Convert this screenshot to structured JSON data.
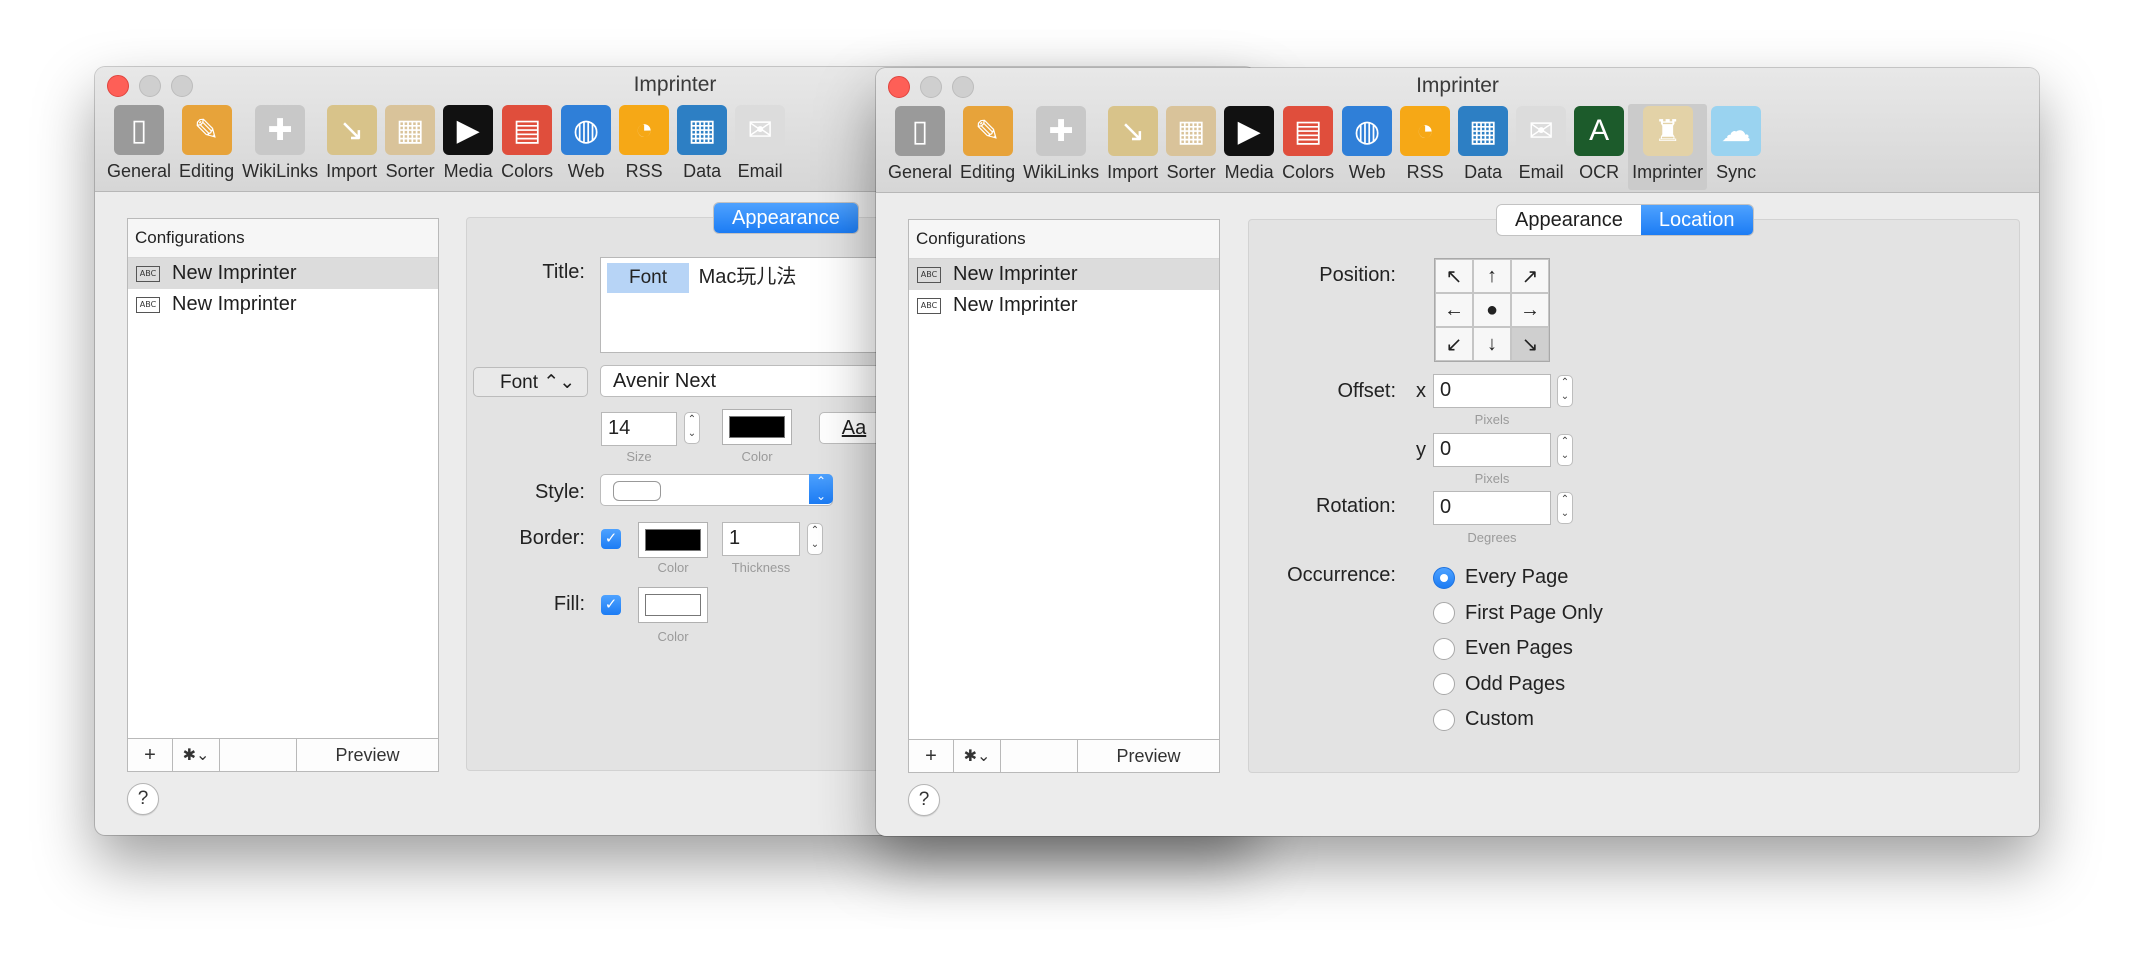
{
  "left_window": {
    "title": "Imprinter",
    "toolbar": [
      {
        "label": "General",
        "icon": "general-icon",
        "glyph": "▯",
        "color": "#9a9a9a"
      },
      {
        "label": "Editing",
        "icon": "pencil-ruler-icon",
        "glyph": "✎",
        "color": "#e7a33a"
      },
      {
        "label": "WikiLinks",
        "icon": "puzzle-icon",
        "glyph": "✚",
        "color": "#c8c8c8"
      },
      {
        "label": "Import",
        "icon": "import-icon",
        "glyph": "↘",
        "color": "#d8c38a"
      },
      {
        "label": "Sorter",
        "icon": "sorter-icon",
        "glyph": "▦",
        "color": "#d9c39a"
      },
      {
        "label": "Media",
        "icon": "media-icon",
        "glyph": "▶",
        "color": "#111111"
      },
      {
        "label": "Colors",
        "icon": "colors-icon",
        "glyph": "▤",
        "color": "#e04e3c"
      },
      {
        "label": "Web",
        "icon": "globe-icon",
        "glyph": "◍",
        "color": "#2f7fd8"
      },
      {
        "label": "RSS",
        "icon": "rss-icon",
        "glyph": "◔",
        "color": "#f6a816"
      },
      {
        "label": "Data",
        "icon": "data-icon",
        "glyph": "▦",
        "color": "#2d7fc4"
      },
      {
        "label": "Email",
        "icon": "email-icon",
        "glyph": "✉",
        "color": "#dcdcdc"
      }
    ],
    "configurations": {
      "header": "Configurations",
      "items": [
        "New Imprinter",
        "New Imprinter"
      ],
      "add": "+",
      "gear": "✱⌄",
      "preview": "Preview"
    },
    "help": "?",
    "tab_appearance": "Appearance",
    "title_label": "Title:",
    "title_token": "Font",
    "title_text": "Mac玩儿法",
    "font_popup": "Font ⌃⌄",
    "font_name": "Avenir Next",
    "size_value": "14",
    "size_caption": "Size",
    "color_caption": "Color",
    "aa_label": "Aa",
    "style_label": "Style:",
    "border_label": "Border:",
    "border_color_caption": "Color",
    "thickness_value": "1",
    "thickness_caption": "Thickness",
    "fill_label": "Fill:",
    "fill_color_caption": "Color",
    "check": "✓"
  },
  "right_window": {
    "title": "Imprinter",
    "toolbar": [
      {
        "label": "General",
        "icon": "general-icon",
        "glyph": "▯",
        "color": "#9a9a9a"
      },
      {
        "label": "Editing",
        "icon": "pencil-ruler-icon",
        "glyph": "✎",
        "color": "#e7a33a"
      },
      {
        "label": "WikiLinks",
        "icon": "puzzle-icon",
        "glyph": "✚",
        "color": "#c8c8c8"
      },
      {
        "label": "Import",
        "icon": "import-icon",
        "glyph": "↘",
        "color": "#d8c38a"
      },
      {
        "label": "Sorter",
        "icon": "sorter-icon",
        "glyph": "▦",
        "color": "#d9c39a"
      },
      {
        "label": "Media",
        "icon": "media-icon",
        "glyph": "▶",
        "color": "#111111"
      },
      {
        "label": "Colors",
        "icon": "colors-icon",
        "glyph": "▤",
        "color": "#e04e3c"
      },
      {
        "label": "Web",
        "icon": "globe-icon",
        "glyph": "◍",
        "color": "#2f7fd8"
      },
      {
        "label": "RSS",
        "icon": "rss-icon",
        "glyph": "◔",
        "color": "#f6a816"
      },
      {
        "label": "Data",
        "icon": "data-icon",
        "glyph": "▦",
        "color": "#2d7fc4"
      },
      {
        "label": "Email",
        "icon": "email-icon",
        "glyph": "✉",
        "color": "#dcdcdc"
      },
      {
        "label": "OCR",
        "icon": "ocr-icon",
        "glyph": "A",
        "color": "#1c5b2b"
      },
      {
        "label": "Imprinter",
        "icon": "stamp-icon",
        "glyph": "♜",
        "color": "#e3d2a7"
      },
      {
        "label": "Sync",
        "icon": "sync-cloud-icon",
        "glyph": "☁",
        "color": "#9ad3f0"
      }
    ],
    "selected_tool": "Imprinter",
    "configurations": {
      "header": "Configurations",
      "items": [
        "New Imprinter",
        "New Imprinter"
      ],
      "add": "+",
      "gear": "✱⌄",
      "preview": "Preview"
    },
    "help": "?",
    "tabs": [
      "Appearance",
      "Location"
    ],
    "active_tab": "Location",
    "position_label": "Position:",
    "position_grid": [
      "↖",
      "↑",
      "↗",
      "←",
      "●",
      "→",
      "↙",
      "↓",
      "↘"
    ],
    "position_selected": 8,
    "offset_label": "Offset:",
    "x_label": "x",
    "x_value": "0",
    "y_label": "y",
    "y_value": "0",
    "pixels_caption": "Pixels",
    "rotation_label": "Rotation:",
    "rotation_value": "0",
    "degrees_caption": "Degrees",
    "occurrence_label": "Occurrence:",
    "occurrence_options": [
      "Every Page",
      "First Page Only",
      "Even Pages",
      "Odd Pages",
      "Custom"
    ],
    "occurrence_selected": "Every Page"
  },
  "colors": {
    "accent": "#1c7cf4",
    "close": "#fe5f57"
  }
}
